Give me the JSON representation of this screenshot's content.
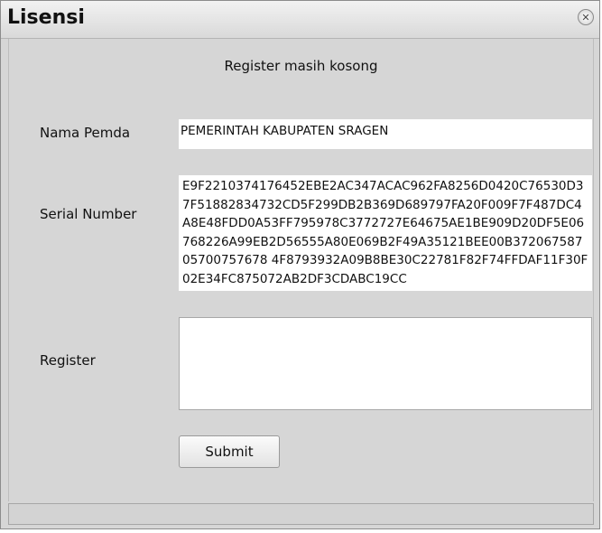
{
  "window": {
    "title": "Lisensi",
    "close_icon": "close-icon"
  },
  "form": {
    "message": "Register masih kosong",
    "nama_pemda": {
      "label": "Nama Pemda",
      "value": "PEMERINTAH KABUPATEN SRAGEN"
    },
    "serial_number": {
      "label": "Serial Number",
      "value": "E9F2210374176452EBE2AC347ACAC962FA8256D0420C76530D37F51882834732CD5F299DB2B369D689797FA20F009F7F487DC4A8E48FDD0A53FF795978C3772727E64675AE1BE909D20DF5E06768226A99EB2D56555A80E069B2F49A35121BEE00B37206758705700757678 4F8793932A09B8BE30C22781F82F74FFDAF11F30F02E34FC875072AB2DF3CDABC19CC"
    },
    "register": {
      "label": "Register",
      "value": ""
    },
    "submit_label": "Submit"
  },
  "colors": {
    "window_bg": "#d6d6d6",
    "field_bg": "#ffffff",
    "text": "#111111"
  }
}
